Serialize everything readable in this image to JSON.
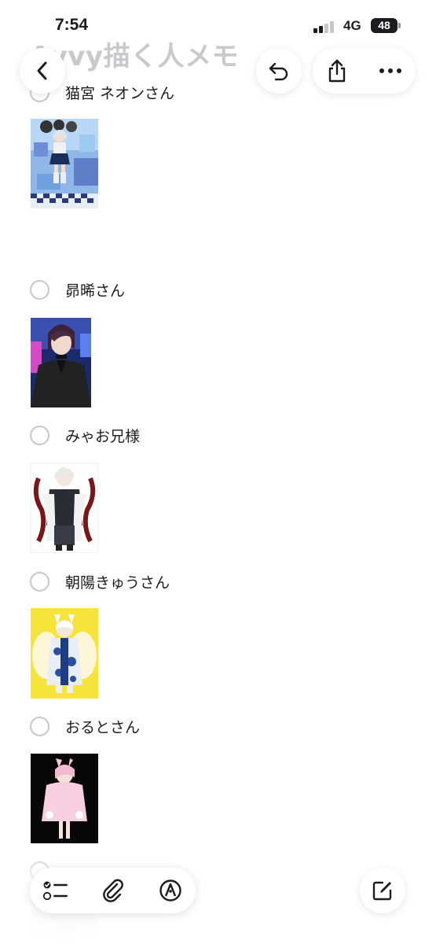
{
  "status": {
    "time": "7:54",
    "network": "4G",
    "battery": "48"
  },
  "note": {
    "title": "Avvy描く人メモ"
  },
  "toolbar": {
    "back_icon": "chevron-left-icon",
    "undo_icon": "undo-icon",
    "share_icon": "share-icon",
    "more_icon": "ellipsis-icon"
  },
  "items": [
    {
      "label": "猫宮 ネオンさん",
      "checked": false
    },
    {
      "label": "昴晞さん",
      "checked": false
    },
    {
      "label": "みゃお兄様",
      "checked": false
    },
    {
      "label": "朝陽きゅうさん",
      "checked": false
    },
    {
      "label": "おるとさん",
      "checked": false
    },
    {
      "label": "",
      "checked": false
    }
  ],
  "bottom_bar": {
    "checklist_icon": "checklist-icon",
    "attach_icon": "paperclip-icon",
    "markup_icon": "pen-tip-icon",
    "compose_icon": "compose-icon"
  }
}
